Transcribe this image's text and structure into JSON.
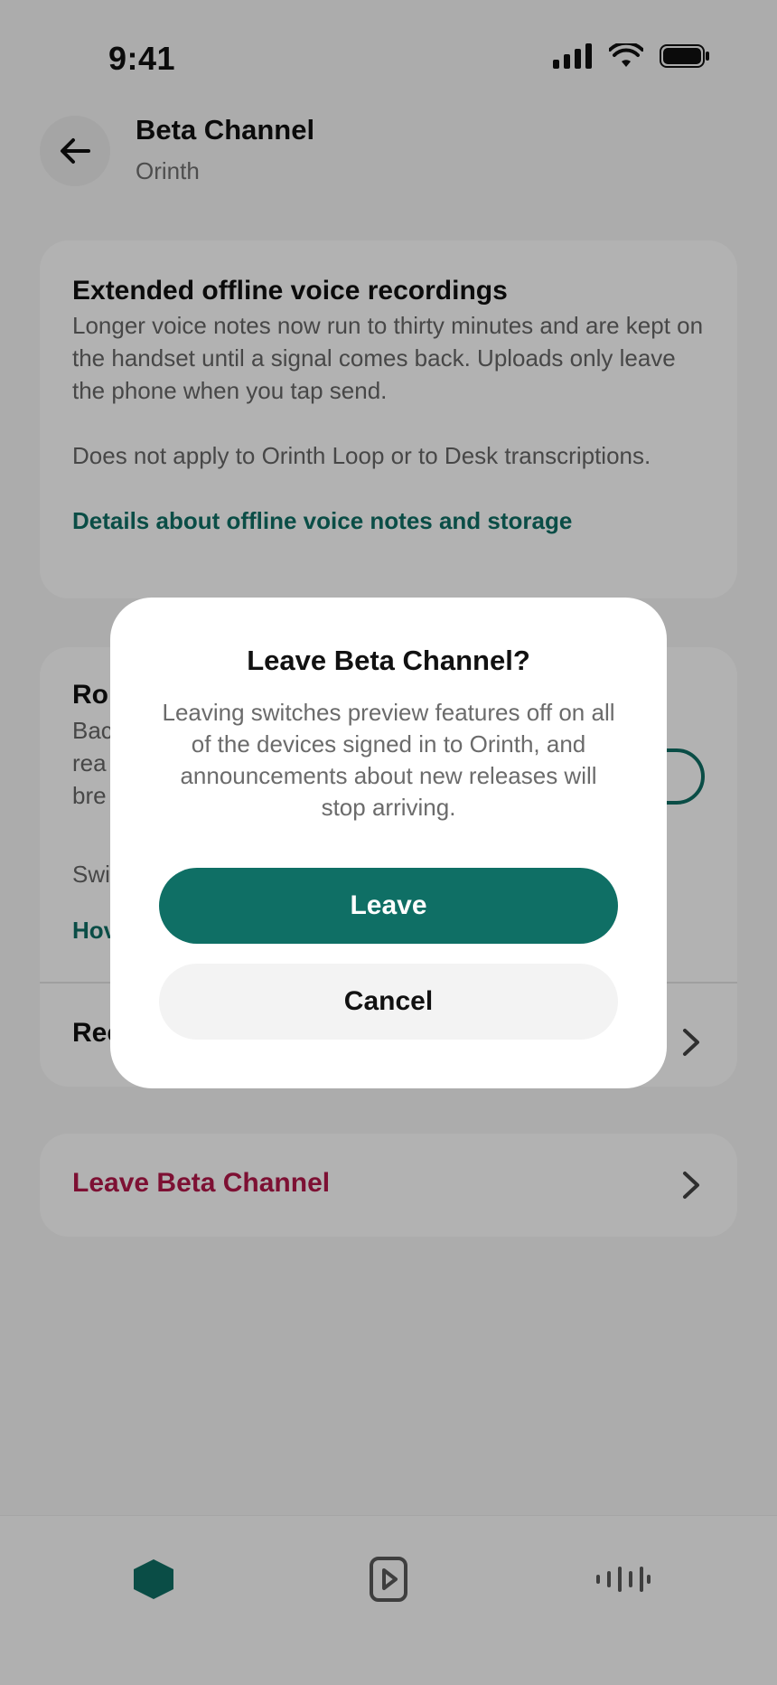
{
  "status_bar": {
    "time": "9:41"
  },
  "header": {
    "title": "Beta Channel",
    "subtitle": "Orinth"
  },
  "feature_card": {
    "title": "Extended offline voice recordings",
    "body_1": "Longer voice notes now run to thirty minutes and are kept on the handset until a signal comes back. Uploads only leave the phone when you tap send.",
    "body_2": "Does not apply to Orinth Loop or to Desk transcriptions.",
    "link": "Details about offline voice notes and storage"
  },
  "partial_card": {
    "title_fragment": "Ro",
    "body_fragments": [
      "Bac",
      "rea",
      "bre"
    ],
    "switch_fragment": "Swi",
    "link_fragment": "Hov",
    "row_fragment": "Rec"
  },
  "leave_row": {
    "label": "Leave Beta Channel"
  },
  "dialog": {
    "title": "Leave Beta Channel?",
    "body": "Leaving switches preview features off on all of the devices signed in to Orinth, and announcements about new releases will stop arriving.",
    "primary_label": "Leave",
    "secondary_label": "Cancel"
  },
  "tab_bar": {
    "tabs": [
      {
        "icon": "hexagon-home-icon",
        "active": true
      },
      {
        "icon": "play-square-icon",
        "active": false
      },
      {
        "icon": "waveform-icon",
        "active": false
      }
    ]
  },
  "colors": {
    "accent": "#0f6f65",
    "danger": "#b4184a",
    "scrim": "rgba(0,0,0,0.30)"
  }
}
